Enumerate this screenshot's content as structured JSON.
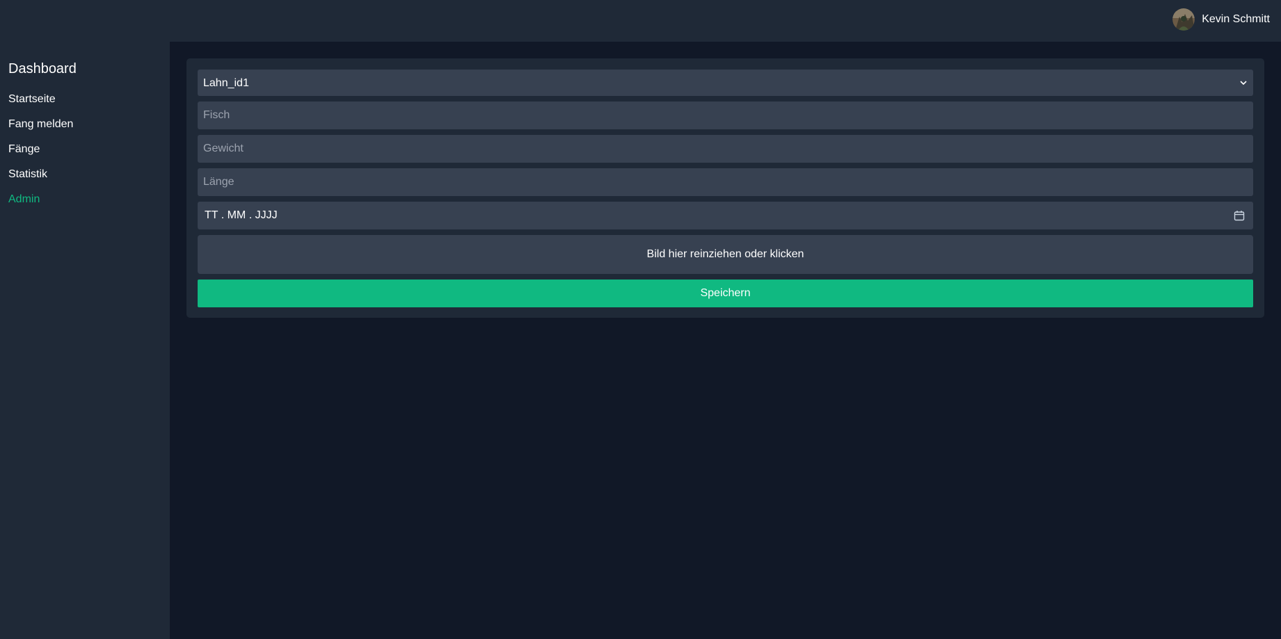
{
  "header": {
    "user_name": "Kevin Schmitt",
    "avatar_icon": "user-avatar"
  },
  "sidebar": {
    "title": "Dashboard",
    "items": [
      {
        "label": "Startseite"
      },
      {
        "label": "Fang melden"
      },
      {
        "label": "Fänge"
      },
      {
        "label": "Statistik"
      },
      {
        "label": "Admin",
        "color": "#10b981"
      }
    ]
  },
  "form": {
    "water_select": {
      "value": "Lahn_id1",
      "options": [
        "Lahn_id1"
      ]
    },
    "fish": {
      "placeholder": "Fisch",
      "value": ""
    },
    "weight": {
      "placeholder": "Gewicht",
      "value": ""
    },
    "length": {
      "placeholder": "Länge",
      "value": ""
    },
    "date": {
      "placeholder": "TT . MM . JJJJ"
    },
    "dropzone_label": "Bild hier reinziehen oder klicken",
    "save_label": "Speichern"
  },
  "colors": {
    "accent": "#10b981",
    "background": "#111827",
    "panel": "#1f2937",
    "field": "#374151"
  }
}
